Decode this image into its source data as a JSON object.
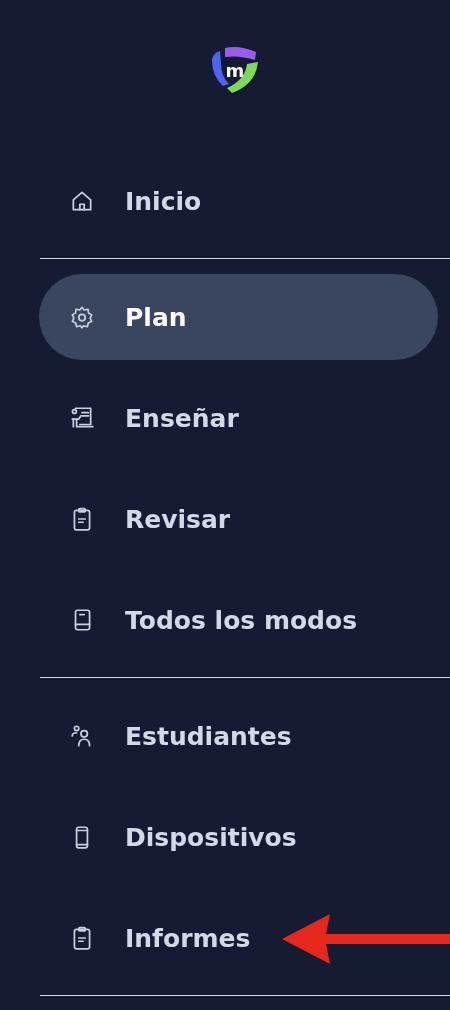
{
  "logo": {
    "letter": "m"
  },
  "sections": [
    {
      "items": [
        {
          "label": "Inicio",
          "selected": false
        }
      ]
    },
    {
      "items": [
        {
          "label": "Plan",
          "selected": true
        },
        {
          "label": "Enseñar",
          "selected": false
        },
        {
          "label": "Revisar",
          "selected": false
        },
        {
          "label": "Todos los modos",
          "selected": false
        }
      ]
    },
    {
      "items": [
        {
          "label": "Estudiantes",
          "selected": false
        },
        {
          "label": "Dispositivos",
          "selected": false
        },
        {
          "label": "Informes",
          "selected": false
        }
      ]
    }
  ]
}
